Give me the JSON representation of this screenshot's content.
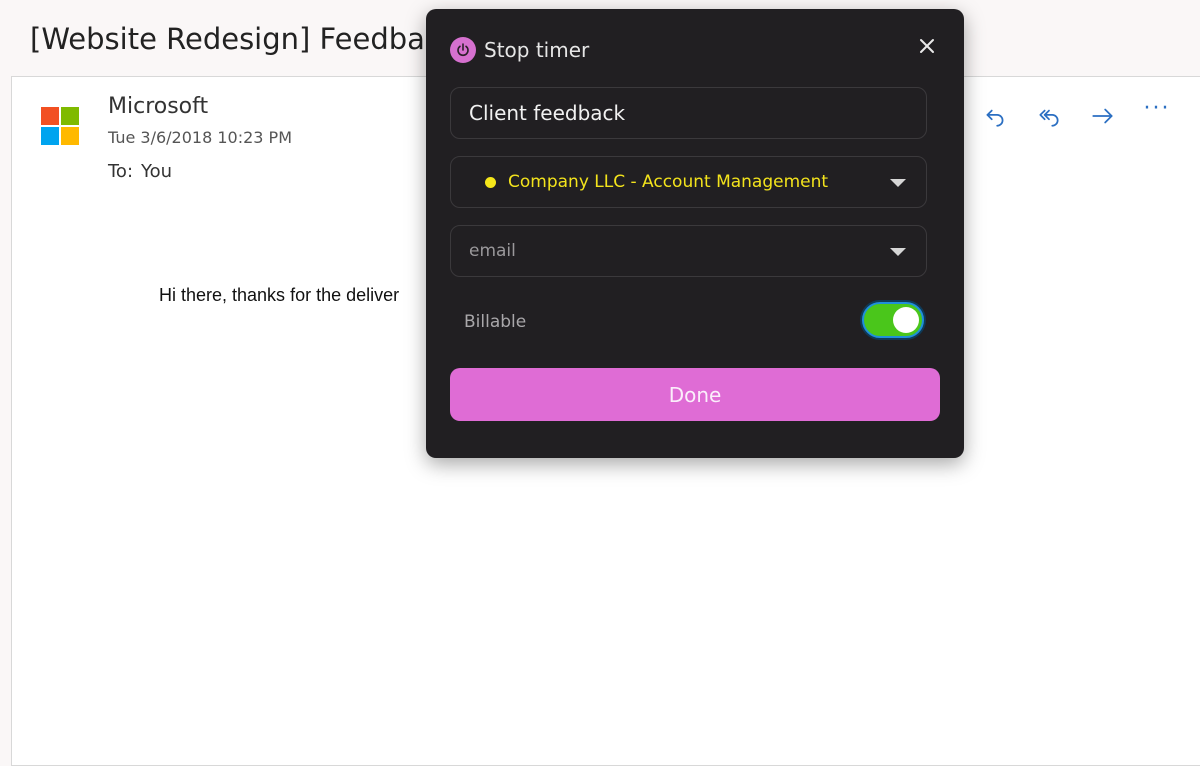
{
  "email": {
    "subject": "[Website Redesign] Feedback",
    "sender": "Microsoft",
    "date": "Tue 3/6/2018 10:23 PM",
    "to_label": "To:",
    "to_name": "You",
    "body_visible": "Hi there, thanks for the deliver",
    "logo_colors": [
      "#f25022",
      "#7fba00",
      "#00a4ef",
      "#ffb900"
    ],
    "actions": {
      "reply_icon": "reply-icon",
      "reply_all_icon": "reply-all-icon",
      "forward_icon": "forward-icon",
      "more_label": "···"
    }
  },
  "timer_popup": {
    "title": "Stop timer",
    "power_icon": "power-icon",
    "close_icon": "close-icon",
    "description_value": "Client feedback",
    "project_label": "Company LLC - Account Management",
    "project_color": "#f5e61a",
    "tag_placeholder": "email",
    "billable_label": "Billable",
    "billable_on": true,
    "done_label": "Done",
    "accent_color": "#df6cd5"
  }
}
